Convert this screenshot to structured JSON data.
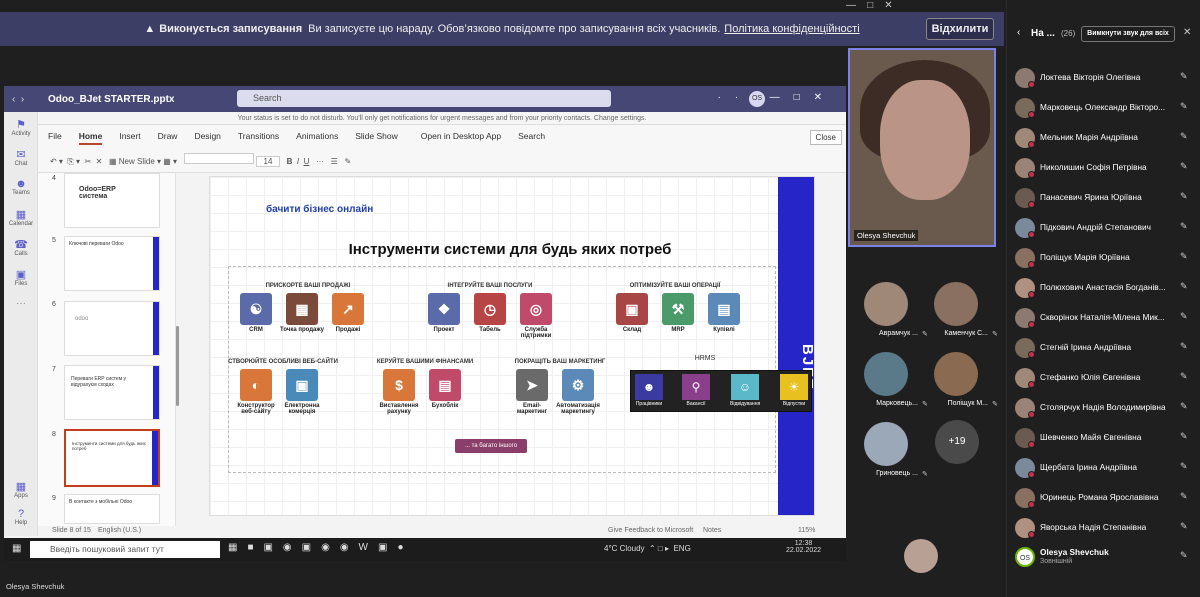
{
  "banner": {
    "title": "Виконується записування",
    "text": "Ви записуєте цю нараду. Обов’язково повідомте про записування всіх учасників.",
    "link": "Політика конфіденційності",
    "button": "Відхилити"
  },
  "ppt": {
    "file": "Odoo_BJet STARTER.pptx",
    "search": "Search",
    "avatar": "OS",
    "notice": "Your status is set to do not disturb. You'll only get notifications for urgent messages and from your priority contacts. Change settings.",
    "tabs": [
      "File",
      "Home",
      "Insert",
      "Draw",
      "Design",
      "Transitions",
      "Animations",
      "Slide Show",
      "Open in Desktop App",
      "Search"
    ],
    "close": "Close",
    "new_slide": "New Slide",
    "font_size": "14",
    "rail": [
      "Activity",
      "Chat",
      "Teams",
      "Calendar",
      "Calls",
      "Files",
      "Apps",
      "Help"
    ],
    "thumbs": [
      {
        "n": "4",
        "text": "Odoo=ERP система"
      },
      {
        "n": "5",
        "text": "Ключові переваги Odoo"
      },
      {
        "n": "6",
        "text": "odoo"
      },
      {
        "n": "7",
        "text": "Переваги ERP систем у відурахуєм сходах"
      },
      {
        "n": "8",
        "text": "Інструменти системи для будь яких потреб"
      },
      {
        "n": "9",
        "text": "В контакте з мобільні Odoo"
      }
    ],
    "status": {
      "slide": "Slide 8 of 15",
      "lang": "English (U.S.)",
      "feedback": "Give Feedback to Microsoft",
      "notes": "Notes",
      "zoom": "115%"
    }
  },
  "slide": {
    "subtitle": "бачити бізнес онлайн",
    "title": "Інструменти системи для будь яких потреб",
    "brand": "BJET",
    "sections": [
      "ПРИСКОРТЕ ВАШІ ПРОДАЖІ",
      "ІНТЕГРУЙТЕ ВАШІ ПОСЛУГИ",
      "ОПТИМІЗУЙТЕ ВАШІ ОПЕРАЦІЇ",
      "СТВОРЮЙТЕ ОСОБЛИВІ ВЕБ-САЙТИ",
      "КЕРУЙТЕ ВАШИМИ ФІНАНСАМИ",
      "ПОКРАЩІТЬ ВАШ МАРКЕТИНГ",
      "HRMS"
    ],
    "apps": [
      "CRM",
      "Точка продажу",
      "Продажі",
      "Проект",
      "Табель",
      "Служба підтримки",
      "Склад",
      "MRP",
      "Купівлі",
      "Конструктор веб-сайту",
      "Електронна комерція",
      "Виставлення рахунку",
      "Бухоблік",
      "Email-маркетинг",
      "Автоматизація маркетингу"
    ],
    "hr": [
      "Працівники",
      "Вакансії",
      "Відвідування",
      "Відпустки"
    ],
    "more": "... та багато іншого"
  },
  "taskbar": {
    "search": "Введіть пошуковий запит тут",
    "weather": "4°C Cloudy",
    "lang": "ENG",
    "time": "12:38",
    "date": "22.02.2022"
  },
  "videos": {
    "main": "Olesya Shevchuk",
    "tiles": [
      "Аврамчук ...",
      "Каменчук С...",
      "Марковець...",
      "Поліщук М...",
      "Гриновець ..."
    ],
    "more": "+19"
  },
  "panel": {
    "title": "На ...",
    "count": "(26)",
    "mute": "Вимкнути звук для всіх",
    "people": [
      "Локтева Вікторія Олегівна",
      "Марковець Олександр Вікторо...",
      "Мельник Марія Андріївна",
      "Николишин Софія Петрівна",
      "Панасевич Ярина Юріївна",
      "Підкович Андрій Степанович",
      "Поліщук Марія Юріївна",
      "Полюхович Анастасія Богданів...",
      "Скворінок Наталія-Мілена Мик...",
      "Стегній Ірина Андріївна",
      "Стефанко Юлія Євгенівна",
      "Столярчук Надія Володимирівна",
      "Шевченко Майя Євгенівна",
      "Щербата Ірина Андріївна",
      "Юринець Романа Ярославівна",
      "Яворська Надія Степанівна"
    ],
    "self": {
      "name": "Olesya Shevchuk",
      "role": "Зовнішній",
      "initials": "OS"
    }
  },
  "bottom_name": "Olesya Shevchuk",
  "colors": {
    "banner": "#3d3e66",
    "teams_purple": "#464775",
    "slide_blue": "#2626c8",
    "accent": "#7b83eb"
  }
}
